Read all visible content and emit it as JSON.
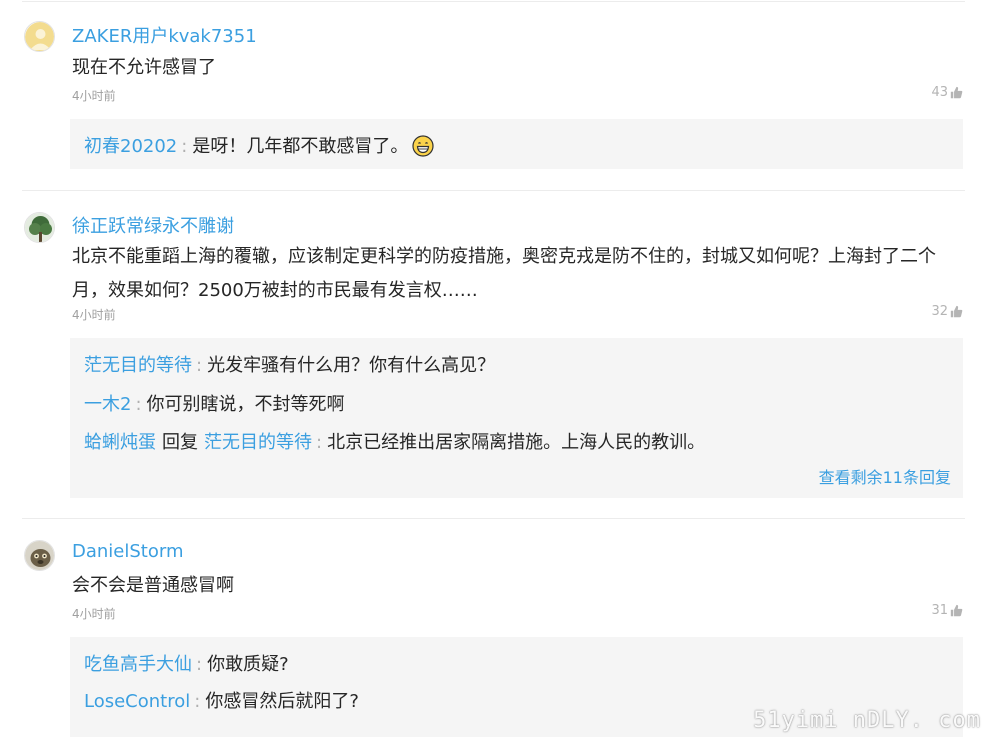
{
  "comments": [
    {
      "username": "ZAKER用户kvak7351",
      "content": "现在不允许感冒了",
      "time": "4小时前",
      "likes": "43",
      "replies": [
        {
          "name": "初春20202",
          "sep": ":",
          "text": "是呀！几年都不敢感冒了。",
          "emoji": "grinning-face"
        }
      ]
    },
    {
      "username": "徐正跃常绿永不雕谢",
      "content": "北京不能重蹈上海的覆辙，应该制定更科学的防疫措施，奥密克戎是防不住的，封城又如何呢？上海封了二个月，效果如何？2500万被封的市民最有发言权……",
      "time": "4小时前",
      "likes": "32",
      "replies": [
        {
          "name": "茫无目的等待",
          "sep": ":",
          "text": "光发牢骚有什么用？你有什么高见？"
        },
        {
          "name": "一木2",
          "sep": ":",
          "text": "你可别瞎说，不封等死啊"
        },
        {
          "name": "蛤蜊炖蛋",
          "mid": "回复",
          "to": "茫无目的等待",
          "sep": ":",
          "text": "北京已经推出居家隔离措施。上海人民的教训。"
        }
      ],
      "more": "查看剩余11条回复"
    },
    {
      "username": "DanielStorm",
      "content": "会不会是普通感冒啊",
      "time": "4小时前",
      "likes": "31",
      "replies": [
        {
          "name": "吃鱼高手大仙",
          "sep": ":",
          "text": "你敢质疑?"
        },
        {
          "name": "LoseControl",
          "sep": ":",
          "text": "你感冒然后就阳了?"
        }
      ]
    }
  ],
  "watermark": "51yimi nDLY. com",
  "colors": {
    "link": "#3b9fe0",
    "muted": "#a0a0a0",
    "reply_bg": "#f5f5f5"
  },
  "icons": {
    "like": "thumbs-up-icon",
    "emoji": "grinning-face-emoji"
  }
}
